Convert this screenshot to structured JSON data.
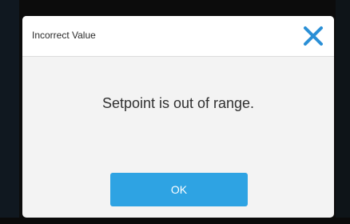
{
  "dialog": {
    "title": "Incorrect Value",
    "message": "Setpoint is out of range.",
    "ok_label": "OK",
    "close_icon": "close-icon"
  },
  "colors": {
    "accent": "#2ea3e3",
    "close_icon": "#2a8fd6",
    "dialog_background": "#f3f3f3",
    "header_background": "#ffffff",
    "screen_background": "#0c0c0c"
  }
}
